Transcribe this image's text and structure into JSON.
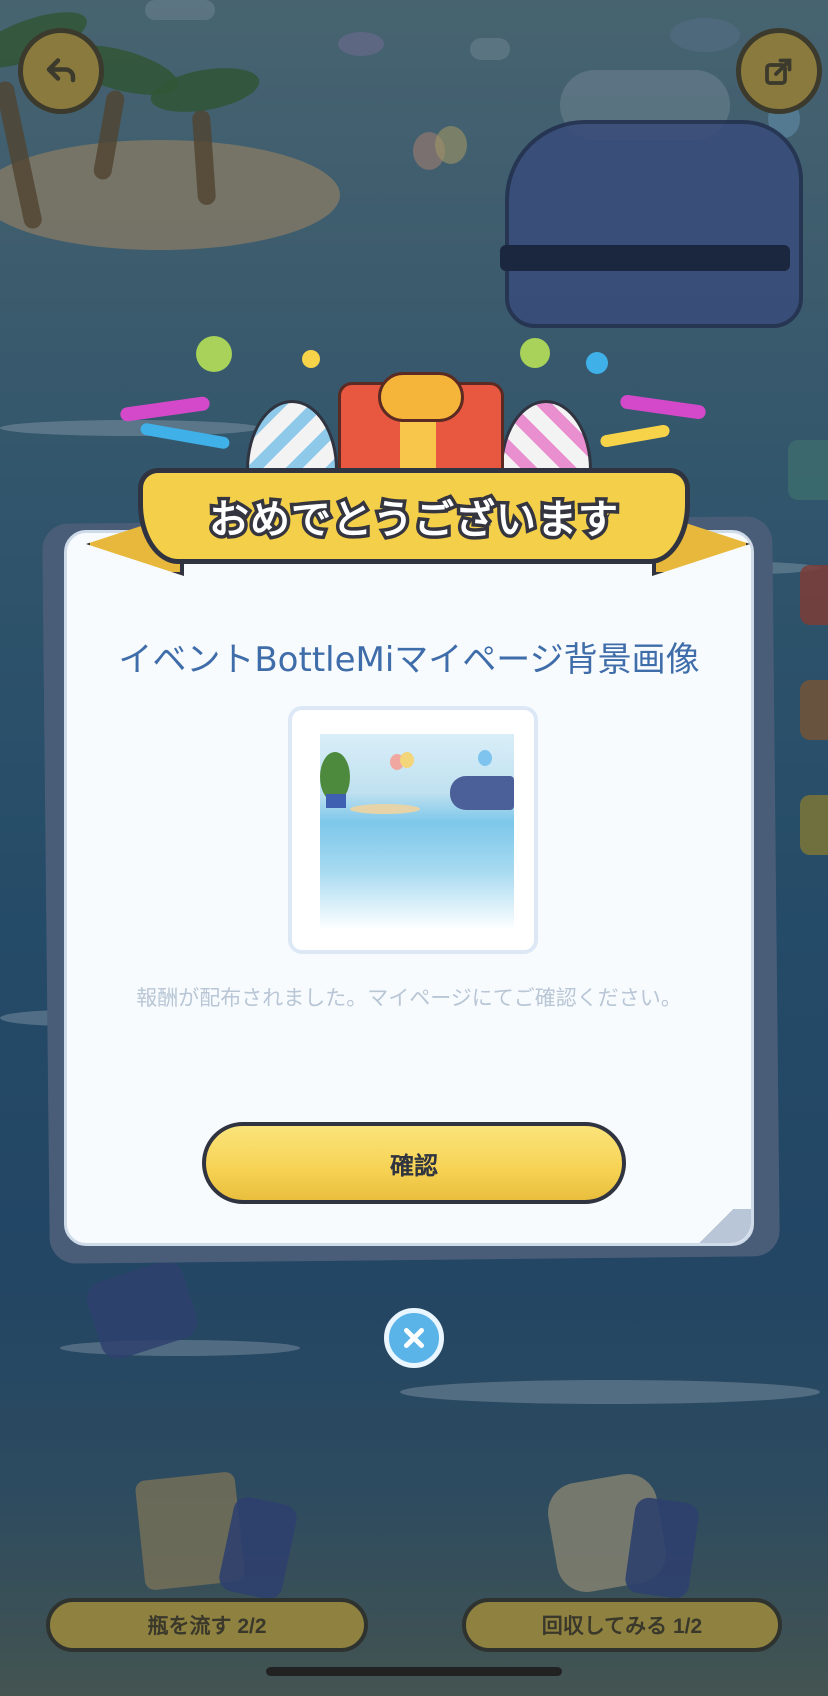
{
  "dialog": {
    "banner_title": "おめでとうございます",
    "reward_title": "イベントBottleMiマイページ背景画像",
    "reward_description": "報酬が配布されました。マイページにてご確認ください。",
    "confirm_label": "確認",
    "close_icon": "close-icon"
  },
  "bottom_actions": {
    "send_bottle_label": "瓶を流す 2/2",
    "collect_label": "回収してみる 1/2"
  },
  "icons": {
    "back": "back-arrow-icon",
    "share": "share-icon"
  },
  "colors": {
    "banner_yellow": "#f4cf4a",
    "title_blue": "#3f6da9",
    "button_yellow": "#f6d253",
    "close_blue": "#5bb4e8"
  }
}
